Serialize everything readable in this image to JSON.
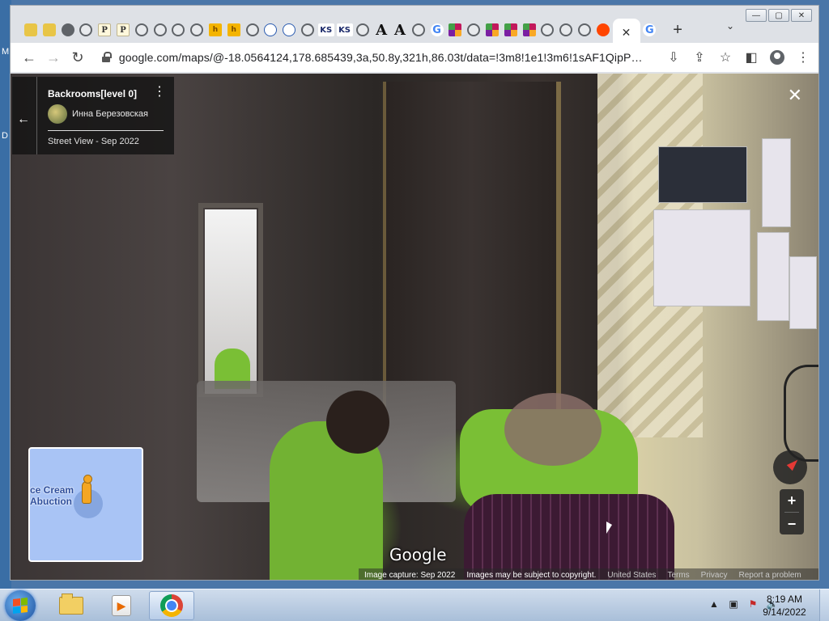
{
  "browser": {
    "url": "google.com/maps/@-18.0564124,178.685439,3a,50.8y,321h,86.03t/data=!3m8!1e1!3m6!1sAF1QipPBP...",
    "tabs": [
      {
        "icon": "bird-icon"
      },
      {
        "icon": "bird-icon"
      },
      {
        "icon": "gear-icon"
      },
      {
        "icon": "globe-icon"
      },
      {
        "icon": "p-icon",
        "text": "P"
      },
      {
        "icon": "p-icon",
        "text": "P"
      },
      {
        "icon": "globe-icon"
      },
      {
        "icon": "globe-icon"
      },
      {
        "icon": "globe-icon"
      },
      {
        "icon": "globe-icon"
      },
      {
        "icon": "h-icon",
        "text": "h"
      },
      {
        "icon": "h-icon",
        "text": "h"
      },
      {
        "icon": "globe-icon"
      },
      {
        "icon": "ellipse-icon"
      },
      {
        "icon": "ellipse-icon"
      },
      {
        "icon": "globe-icon"
      },
      {
        "icon": "ks-icon",
        "text": "KS"
      },
      {
        "icon": "ks-icon",
        "text": "KS"
      },
      {
        "icon": "globe-icon"
      },
      {
        "icon": "a-icon",
        "text": "A"
      },
      {
        "icon": "a-icon",
        "text": "A"
      },
      {
        "icon": "globe-icon"
      },
      {
        "icon": "google-icon",
        "text": "G"
      },
      {
        "icon": "diamond-icon"
      },
      {
        "icon": "globe-icon"
      },
      {
        "icon": "diamond-icon"
      },
      {
        "icon": "diamond-icon"
      },
      {
        "icon": "diamond-icon"
      },
      {
        "icon": "globe-icon"
      },
      {
        "icon": "globe-icon"
      },
      {
        "icon": "globe-icon"
      },
      {
        "icon": "reddit-icon"
      }
    ],
    "after_active_tab_icon": {
      "icon": "google-icon",
      "text": "G"
    },
    "window_controls": {
      "minimize": "—",
      "maximize": "▢",
      "close": "✕"
    }
  },
  "streetview": {
    "title": "Backrooms[level 0]",
    "uploader": "Инна Березовская",
    "date_label": "Street View - Sep 2022",
    "minimap_label_line1": "ce Cream",
    "minimap_label_line2": "Abuction",
    "google_logo": "Google",
    "footer": {
      "capture": "Image capture: Sep 2022",
      "copyright": "Images may be subject to copyright.",
      "region": "United States",
      "terms": "Terms",
      "privacy": "Privacy",
      "report": "Report a problem"
    }
  },
  "taskbar": {
    "time": "8:19 AM",
    "date": "9/14/2022"
  },
  "desktop": {
    "edge_letters": [
      "M",
      "D"
    ]
  }
}
